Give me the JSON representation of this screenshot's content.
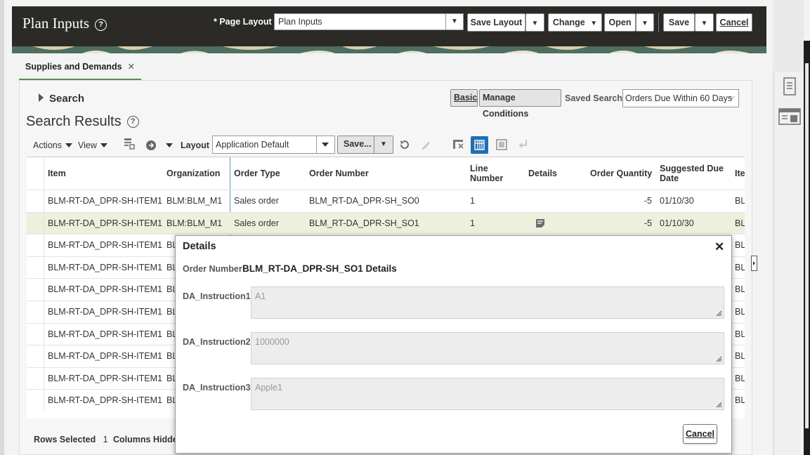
{
  "header": {
    "title": "Plan Inputs",
    "page_layout_label": "* Page Layout",
    "page_layout_value": "Plan Inputs",
    "buttons": {
      "save_layout": "Save Layout",
      "change": "Change",
      "open": "Open",
      "save": "Save",
      "cancel": "Cancel"
    }
  },
  "tabs": [
    {
      "label": "Supplies and Demands",
      "active": true
    }
  ],
  "search": {
    "toggle_label": "Search",
    "basic_label": "Basic",
    "manage_conditions_label": "Manage Conditions",
    "saved_search_label": "Saved Search",
    "saved_search_value": "Orders Due Within 60 Days"
  },
  "results": {
    "title": "Search Results",
    "toolbar": {
      "actions": "Actions",
      "view": "View",
      "layout_label": "Layout",
      "layout_value": "Application Default",
      "save_label": "Save..."
    },
    "columns": [
      "Item",
      "Organization",
      "Order Type",
      "Order Number",
      "Line Number",
      "Details",
      "Order Quantity",
      "Suggested Due Date",
      "Ite"
    ],
    "rows": [
      {
        "item": "BLM-RT-DA_DPR-SH-ITEM1",
        "organization": "BLM:BLM_M1",
        "order_type": "Sales order",
        "order_number": "BLM_RT-DA_DPR-SH_SO0",
        "line_number": "1",
        "quantity": "-5",
        "due_date": "01/10/30",
        "ite": "BL",
        "selected": false
      },
      {
        "item": "BLM-RT-DA_DPR-SH-ITEM1",
        "organization": "BLM:BLM_M1",
        "order_type": "Sales order",
        "order_number": "BLM_RT-DA_DPR-SH_SO1",
        "line_number": "1",
        "quantity": "-5",
        "due_date": "01/10/30",
        "ite": "BL",
        "selected": true
      },
      {
        "item": "BLM-RT-DA_DPR-SH-ITEM1",
        "organization": "BL",
        "ite": "BL"
      },
      {
        "item": "BLM-RT-DA_DPR-SH-ITEM1",
        "organization": "BL",
        "ite": "BL"
      },
      {
        "item": "BLM-RT-DA_DPR-SH-ITEM1",
        "organization": "BL",
        "ite": "BL"
      },
      {
        "item": "BLM-RT-DA_DPR-SH-ITEM1",
        "organization": "BL",
        "ite": "BL"
      },
      {
        "item": "BLM-RT-DA_DPR-SH-ITEM1",
        "organization": "BL",
        "ite": "BL"
      },
      {
        "item": "BLM-RT-DA_DPR-SH-ITEM1",
        "organization": "BL",
        "ite": "BL"
      },
      {
        "item": "BLM-RT-DA_DPR-SH-ITEM1",
        "organization": "BL",
        "ite": "BL"
      },
      {
        "item": "BLM-RT-DA_DPR-SH-ITEM1",
        "organization": "BL",
        "ite": "BL"
      }
    ],
    "status": {
      "rows_selected_label": "Rows Selected",
      "rows_selected_value": "1",
      "columns_hidden_label": "Columns Hidden"
    }
  },
  "dialog": {
    "title": "Details",
    "order_number_label": "Order Number",
    "order_number_value": "BLM_RT-DA_DPR-SH_SO1 Details",
    "fields": [
      {
        "label": "DA_Instruction1",
        "value": "A1"
      },
      {
        "label": "DA_Instruction2",
        "value": "1000000"
      },
      {
        "label": "DA_Instruction3",
        "value": "Apple1"
      }
    ],
    "cancel_label": "Cancel"
  },
  "colors": {
    "header_bg": "#2b2a27",
    "tab_accent": "#5b8a5b",
    "selected_row": "#ecf0dc",
    "active_icon": "#1f6fb5"
  },
  "icons": [
    "help-icon",
    "close-icon",
    "details-note-icon",
    "refresh-icon",
    "edit-icon",
    "freeze-icon",
    "detach-icon",
    "wrap-icon",
    "columns-icon",
    "go-icon",
    "export-icon",
    "rail-page-icon",
    "rail-layout-icon"
  ]
}
